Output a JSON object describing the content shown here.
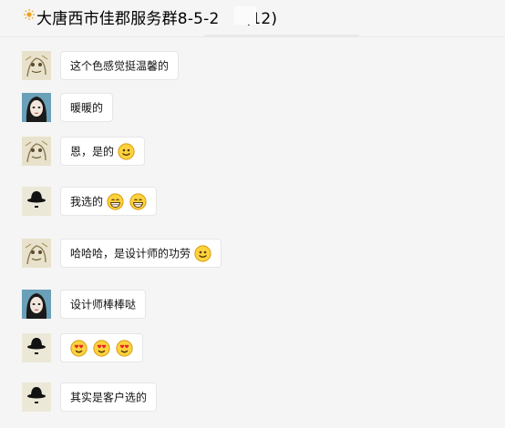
{
  "header": {
    "title_left": "大唐西市佳郡服务群8-5-2",
    "title_count": "(12)"
  },
  "messages": [
    {
      "avatar": "sketch-face-avatar",
      "text": "这个色感觉挺温馨的",
      "emojis": []
    },
    {
      "avatar": "woman-avatar",
      "text": "暖暖的",
      "emojis": []
    },
    {
      "avatar": "sketch-face-avatar",
      "text": "恩，是的",
      "emojis": [
        "smile"
      ]
    },
    {
      "avatar": "bowler-hat-avatar",
      "text": "我选的",
      "emojis": [
        "grin",
        "grin"
      ]
    },
    {
      "avatar": "sketch-face-avatar",
      "text": "哈哈哈，是设计师的功劳",
      "emojis": [
        "smile"
      ]
    },
    {
      "avatar": "woman-avatar",
      "text": "设计师棒棒哒",
      "emojis": []
    },
    {
      "avatar": "bowler-hat-avatar",
      "text": "",
      "emojis": [
        "heart-eyes",
        "heart-eyes",
        "heart-eyes"
      ]
    },
    {
      "avatar": "bowler-hat-avatar",
      "text": "其实是客户选的",
      "emojis": []
    }
  ]
}
